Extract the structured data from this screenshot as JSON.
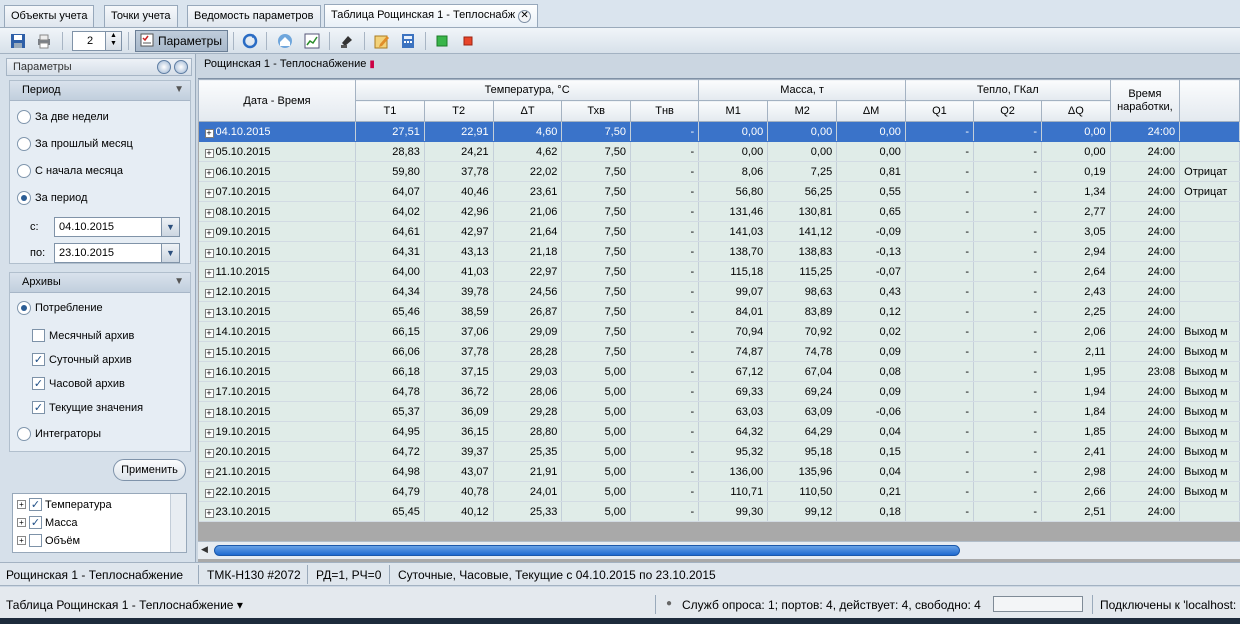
{
  "tabs": [
    {
      "label": "Объекты учета"
    },
    {
      "label": "Точки учета"
    },
    {
      "label": "Ведомость параметров"
    },
    {
      "label": "Таблица Рощинская 1 - Теплоснабж"
    }
  ],
  "toolbar": {
    "copies": "2",
    "params_label": "Параметры"
  },
  "left": {
    "header": "Параметры",
    "period": {
      "title": "Период",
      "options": [
        "За две недели",
        "За прошлый месяц",
        "С начала месяца",
        "За период"
      ],
      "selected": "За период",
      "from_label": "с:",
      "from": "04.10.2015",
      "to_label": "по:",
      "to": "23.10.2015"
    },
    "archives": {
      "title": "Архивы",
      "consumption": "Потребление",
      "monthly": "Месячный архив",
      "daily": "Суточный архив",
      "hourly": "Часовой архив",
      "current": "Текущие значения",
      "integrators": "Интеграторы"
    },
    "apply": "Применить",
    "tree": [
      "Температура",
      "Масса",
      "Объём"
    ]
  },
  "main": {
    "title": "Рощинская 1 - Теплоснабжение",
    "columns": {
      "date": "Дата - Время",
      "temp_group": "Температура, °С",
      "mass_group": "Масса, т",
      "heat_group": "Тепло, ГКал",
      "runtime": "Время наработки,",
      "T1": "T1",
      "T2": "T2",
      "dT": "ΔT",
      "Txv": "Тхв",
      "Tnv": "Тнв",
      "M1": "M1",
      "M2": "M2",
      "dM": "ΔM",
      "Q1": "Q1",
      "Q2": "Q2",
      "dQ": "ΔQ"
    },
    "rows": [
      [
        "04.10.2015",
        "27,51",
        "22,91",
        "4,60",
        "7,50",
        "-",
        "0,00",
        "0,00",
        "0,00",
        "-",
        "-",
        "0,00",
        "24:00",
        ""
      ],
      [
        "05.10.2015",
        "28,83",
        "24,21",
        "4,62",
        "7,50",
        "-",
        "0,00",
        "0,00",
        "0,00",
        "-",
        "-",
        "0,00",
        "24:00",
        ""
      ],
      [
        "06.10.2015",
        "59,80",
        "37,78",
        "22,02",
        "7,50",
        "-",
        "8,06",
        "7,25",
        "0,81",
        "-",
        "-",
        "0,19",
        "24:00",
        "Отрицат"
      ],
      [
        "07.10.2015",
        "64,07",
        "40,46",
        "23,61",
        "7,50",
        "-",
        "56,80",
        "56,25",
        "0,55",
        "-",
        "-",
        "1,34",
        "24:00",
        "Отрицат"
      ],
      [
        "08.10.2015",
        "64,02",
        "42,96",
        "21,06",
        "7,50",
        "-",
        "131,46",
        "130,81",
        "0,65",
        "-",
        "-",
        "2,77",
        "24:00",
        ""
      ],
      [
        "09.10.2015",
        "64,61",
        "42,97",
        "21,64",
        "7,50",
        "-",
        "141,03",
        "141,12",
        "-0,09",
        "-",
        "-",
        "3,05",
        "24:00",
        ""
      ],
      [
        "10.10.2015",
        "64,31",
        "43,13",
        "21,18",
        "7,50",
        "-",
        "138,70",
        "138,83",
        "-0,13",
        "-",
        "-",
        "2,94",
        "24:00",
        ""
      ],
      [
        "11.10.2015",
        "64,00",
        "41,03",
        "22,97",
        "7,50",
        "-",
        "115,18",
        "115,25",
        "-0,07",
        "-",
        "-",
        "2,64",
        "24:00",
        ""
      ],
      [
        "12.10.2015",
        "64,34",
        "39,78",
        "24,56",
        "7,50",
        "-",
        "99,07",
        "98,63",
        "0,43",
        "-",
        "-",
        "2,43",
        "24:00",
        ""
      ],
      [
        "13.10.2015",
        "65,46",
        "38,59",
        "26,87",
        "7,50",
        "-",
        "84,01",
        "83,89",
        "0,12",
        "-",
        "-",
        "2,25",
        "24:00",
        ""
      ],
      [
        "14.10.2015",
        "66,15",
        "37,06",
        "29,09",
        "7,50",
        "-",
        "70,94",
        "70,92",
        "0,02",
        "-",
        "-",
        "2,06",
        "24:00",
        "Выход м"
      ],
      [
        "15.10.2015",
        "66,06",
        "37,78",
        "28,28",
        "7,50",
        "-",
        "74,87",
        "74,78",
        "0,09",
        "-",
        "-",
        "2,11",
        "24:00",
        "Выход м"
      ],
      [
        "16.10.2015",
        "66,18",
        "37,15",
        "29,03",
        "5,00",
        "-",
        "67,12",
        "67,04",
        "0,08",
        "-",
        "-",
        "1,95",
        "23:08",
        "Выход м"
      ],
      [
        "17.10.2015",
        "64,78",
        "36,72",
        "28,06",
        "5,00",
        "-",
        "69,33",
        "69,24",
        "0,09",
        "-",
        "-",
        "1,94",
        "24:00",
        "Выход м"
      ],
      [
        "18.10.2015",
        "65,37",
        "36,09",
        "29,28",
        "5,00",
        "-",
        "63,03",
        "63,09",
        "-0,06",
        "-",
        "-",
        "1,84",
        "24:00",
        "Выход м"
      ],
      [
        "19.10.2015",
        "64,95",
        "36,15",
        "28,80",
        "5,00",
        "-",
        "64,32",
        "64,29",
        "0,04",
        "-",
        "-",
        "1,85",
        "24:00",
        "Выход м"
      ],
      [
        "20.10.2015",
        "64,72",
        "39,37",
        "25,35",
        "5,00",
        "-",
        "95,32",
        "95,18",
        "0,15",
        "-",
        "-",
        "2,41",
        "24:00",
        "Выход м"
      ],
      [
        "21.10.2015",
        "64,98",
        "43,07",
        "21,91",
        "5,00",
        "-",
        "136,00",
        "135,96",
        "0,04",
        "-",
        "-",
        "2,98",
        "24:00",
        "Выход м"
      ],
      [
        "22.10.2015",
        "64,79",
        "40,78",
        "24,01",
        "5,00",
        "-",
        "110,71",
        "110,50",
        "0,21",
        "-",
        "-",
        "2,66",
        "24:00",
        "Выход м"
      ],
      [
        "23.10.2015",
        "65,45",
        "40,12",
        "25,33",
        "5,00",
        "-",
        "99,30",
        "99,12",
        "0,18",
        "-",
        "-",
        "2,51",
        "24:00",
        ""
      ]
    ]
  },
  "status1": [
    "Рощинская 1 - Теплоснабжение",
    "ТМК-Н130 #2072",
    "РД=1, РЧ=0",
    "Суточные, Часовые, Текущие с 04.10.2015 по 23.10.2015"
  ],
  "status2": {
    "left": "Таблица Рощинская 1 - Теплоснабжение ▾",
    "service": "Служб опроса: 1; портов: 4, действует: 4, свободно: 4",
    "connected": "Подключены к 'localhost:"
  }
}
